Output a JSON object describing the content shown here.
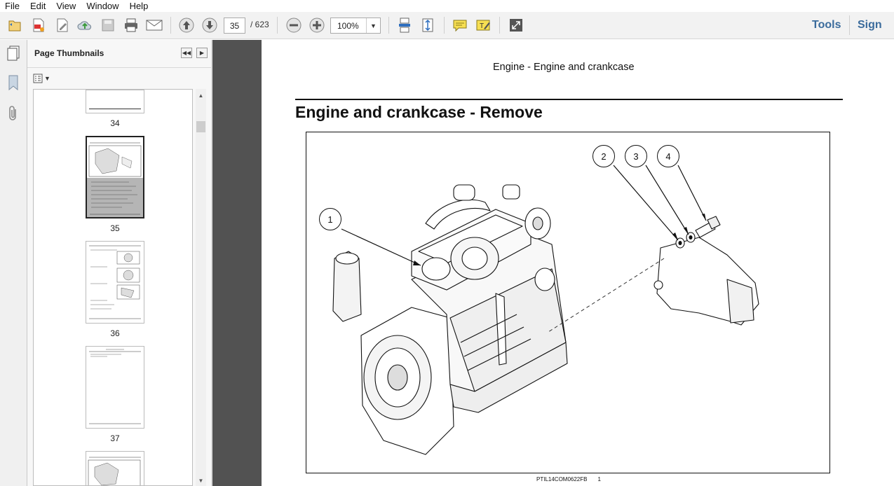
{
  "menu": [
    "File",
    "Edit",
    "View",
    "Window",
    "Help"
  ],
  "toolbar": {
    "page_current": "35",
    "page_total": "/  623",
    "zoom": "100%",
    "tools_label": "Tools",
    "sign_label": "Sign"
  },
  "thumbnails": {
    "title": "Page Thumbnails",
    "pages": [
      "34",
      "35",
      "36",
      "37"
    ]
  },
  "document": {
    "header": "Engine - Engine and crankcase",
    "heading": "Engine and crankcase - Remove",
    "callouts": [
      "1",
      "2",
      "3",
      "4"
    ],
    "footer_code": "PTIL14COM0622FB",
    "footer_num": "1"
  },
  "colors": {
    "accent": "#3a6b9c",
    "doc_background": "#525252",
    "toolbar": "#f2f2f2"
  }
}
